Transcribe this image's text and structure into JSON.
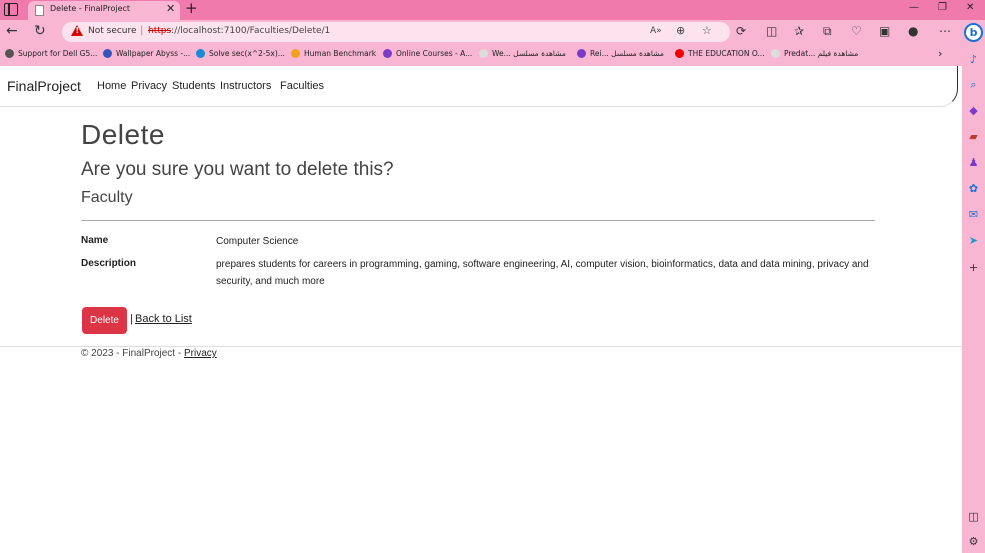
{
  "browser": {
    "tab_title": "Delete - FinalProject",
    "not_secure": "Not secure",
    "url_scheme": "https",
    "url_rest": "://localhost:7100/Faculties/Delete/1",
    "bookmarks": [
      {
        "label": "Support for Dell G5...",
        "color": "#555"
      },
      {
        "label": "Wallpaper Abyss -...",
        "color": "#3355bb"
      },
      {
        "label": "Solve sec(x^2-5x)...",
        "color": "#1b8ad6"
      },
      {
        "label": "Human Benchmark",
        "color": "#f0a020"
      },
      {
        "label": "Online Courses - A...",
        "color": "#7a3cc8"
      },
      {
        "label": "We... مشاهدة مسلسل",
        "color": "#ddd"
      },
      {
        "label": "Rei... مشاهدة مسلسل",
        "color": "#7a3cc8"
      },
      {
        "label": "THE EDUCATION O...",
        "color": "#e00"
      },
      {
        "label": "Predat... مشاهدة فيلم",
        "color": "#ddd"
      }
    ]
  },
  "nav": {
    "brand": "FinalProject",
    "links": [
      "Home",
      "Privacy",
      "Students",
      "Instructors",
      "Faculties"
    ]
  },
  "page": {
    "title": "Delete",
    "question": "Are you sure you want to delete this?",
    "entity": "Faculty",
    "fields": [
      {
        "label": "Name",
        "value": "Computer Science"
      },
      {
        "label": "Description",
        "value": "prepares students for careers in programming, gaming, software engineering, AI, computer vision, bioinformatics, data and data mining, privacy and security, and much more"
      }
    ],
    "delete_label": "Delete",
    "separator": "|",
    "back_label": "Back to List"
  },
  "footer": {
    "text": "© 2023 - FinalProject - ",
    "privacy": "Privacy"
  },
  "colors": {
    "chrome": "#f9b6d3",
    "titlebar": "#f07aab",
    "danger": "#dc3545"
  }
}
